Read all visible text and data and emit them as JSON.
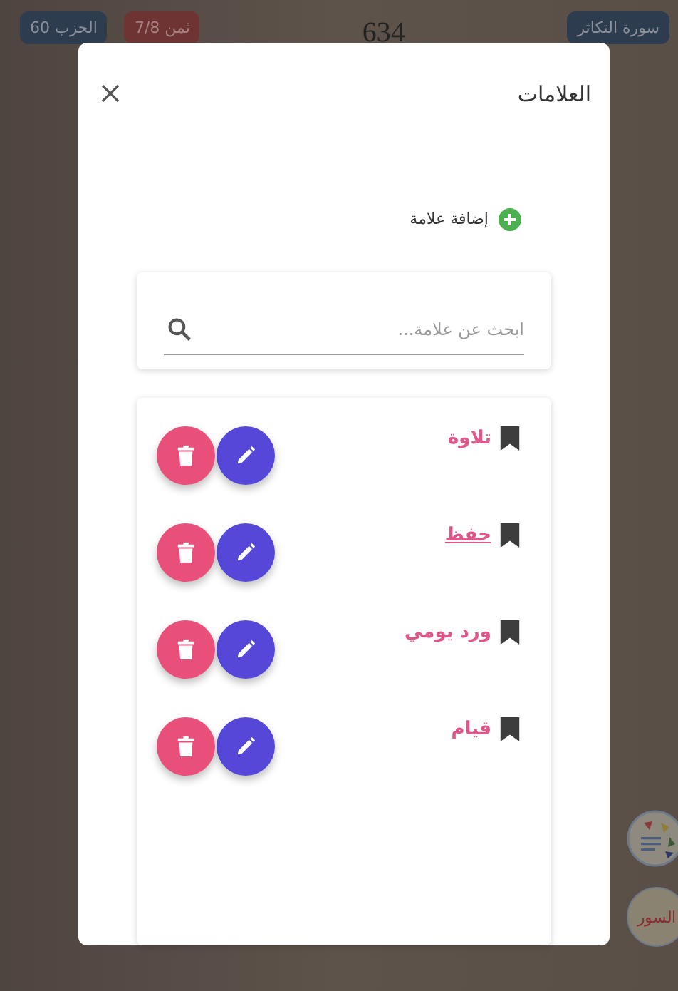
{
  "page_header": {
    "chips": [
      {
        "label": "سورة التكاثر",
        "kind": "surah"
      },
      {
        "label": "ثمن 7/8",
        "kind": "eighth"
      },
      {
        "label": "الحزب 60",
        "kind": "hizb"
      }
    ],
    "page_number": "634"
  },
  "side_buttons": [
    {
      "kind": "palette"
    },
    {
      "kind": "text",
      "label": "السور"
    }
  ],
  "dialog": {
    "title": "العلامات",
    "add_label": "إضافة علامة",
    "search": {
      "placeholder": "ابحث عن علامة..."
    },
    "bookmarks": [
      {
        "name": "تلاوة",
        "underlined": false
      },
      {
        "name": "حفظ",
        "underlined": true
      },
      {
        "name": "ورد يومي",
        "underlined": false
      },
      {
        "name": "قيام",
        "underlined": false
      }
    ]
  }
}
